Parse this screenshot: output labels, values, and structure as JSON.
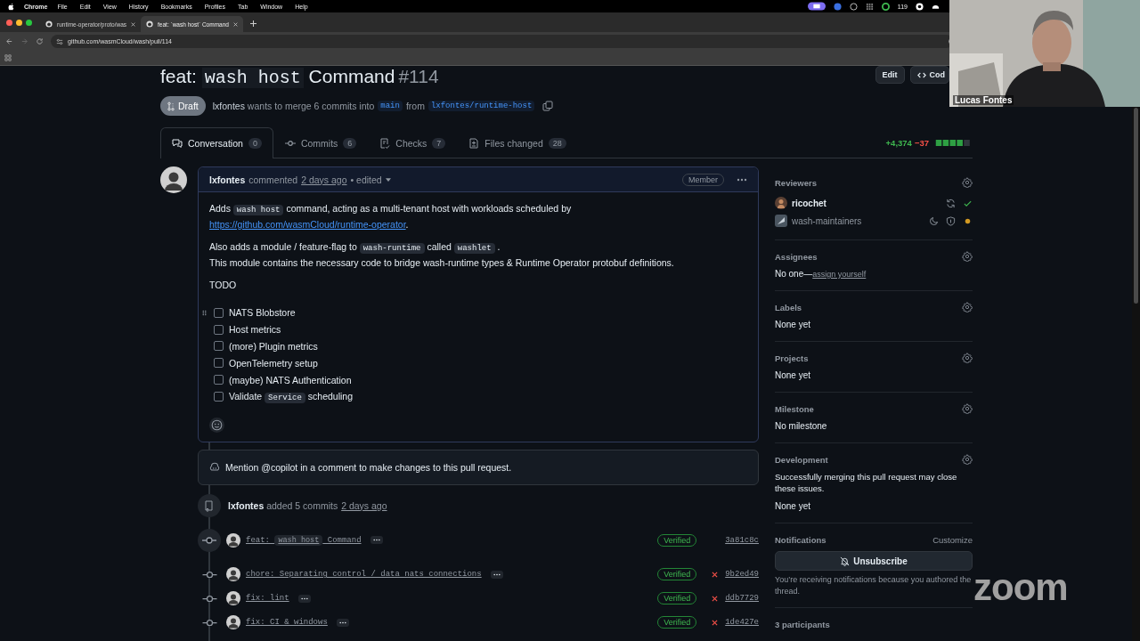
{
  "menubar": {
    "app": "Chrome",
    "items": [
      "File",
      "Edit",
      "View",
      "History",
      "Bookmarks",
      "Profiles",
      "Tab",
      "Window",
      "Help"
    ],
    "status_text": "119"
  },
  "browser_tabs": [
    {
      "title": "runtime-operator/proto/was",
      "selected": false
    },
    {
      "title": "feat: `wash host` Command",
      "selected": true
    }
  ],
  "address_bar": {
    "url": "github.com/wasmCloud/wash/pull/114"
  },
  "pr": {
    "title": [
      {
        "kind": "text",
        "text": "feat: "
      },
      {
        "kind": "code",
        "text": "wash host"
      },
      {
        "kind": "text",
        "text": " Command"
      }
    ],
    "number": "#114",
    "actions": [
      "Edit",
      "Cod"
    ],
    "state": "Draft",
    "author": "lxfontes",
    "merge_text": "wants to merge 6 commits into",
    "base": "main",
    "from_text": "from",
    "head": "lxfontes/runtime-host"
  },
  "tabs": [
    {
      "label": "Conversation",
      "count": "0",
      "selected": true
    },
    {
      "label": "Commits",
      "count": "6",
      "selected": false
    },
    {
      "label": "Checks",
      "count": "7",
      "selected": false
    },
    {
      "label": "Files changed",
      "count": "28",
      "selected": false
    }
  ],
  "diffstat": {
    "added": "+4,374",
    "removed": "−37"
  },
  "comment": {
    "author": "lxfontes",
    "action": "commented",
    "time": "2 days ago",
    "edited": "• edited",
    "badge": "Member",
    "paragraphs": [
      [
        [
          {
            "kind": "text",
            "text": "Adds "
          },
          {
            "kind": "code",
            "text": "wash host"
          },
          {
            "kind": "text",
            "text": " command, acting as a multi-tenant host with workloads scheduled by"
          }
        ],
        [
          {
            "kind": "link",
            "text": "https://github.com/wasmCloud/runtime-operator"
          },
          {
            "kind": "text",
            "text": "."
          }
        ]
      ],
      [
        [
          {
            "kind": "text",
            "text": "Also adds a module / feature-flag to "
          },
          {
            "kind": "code",
            "text": "wash-runtime"
          },
          {
            "kind": "text",
            "text": " called "
          },
          {
            "kind": "code",
            "text": "washlet"
          },
          {
            "kind": "text",
            "text": " ."
          }
        ],
        [
          {
            "kind": "text",
            "text": "This module contains the necessary code to bridge wash-runtime types & Runtime Operator protobuf definitions."
          }
        ]
      ],
      [
        [
          {
            "kind": "text",
            "text": "TODO"
          }
        ]
      ]
    ],
    "tasks": [
      {
        "checked": false,
        "text": [
          {
            "kind": "text",
            "text": "NATS Blobstore"
          }
        ]
      },
      {
        "checked": false,
        "text": [
          {
            "kind": "text",
            "text": "Host metrics"
          }
        ]
      },
      {
        "checked": false,
        "text": [
          {
            "kind": "text",
            "text": "(more) Plugin metrics"
          }
        ]
      },
      {
        "checked": false,
        "text": [
          {
            "kind": "text",
            "text": "OpenTelemetry setup"
          }
        ]
      },
      {
        "checked": false,
        "text": [
          {
            "kind": "text",
            "text": "(maybe) NATS Authentication"
          }
        ]
      },
      {
        "checked": false,
        "text": [
          {
            "kind": "text",
            "text": "Validate "
          },
          {
            "kind": "code",
            "text": "Service"
          },
          {
            "kind": "text",
            "text": " scheduling"
          }
        ]
      }
    ]
  },
  "copilot_notice": "Mention @copilot in a comment to make changes to this pull request.",
  "event": {
    "author": "lxfontes",
    "action": "added 5 commits",
    "time": "2 days ago"
  },
  "commits": [
    {
      "message": [
        {
          "kind": "text",
          "text": "feat: "
        },
        {
          "kind": "code",
          "text": "wash host"
        },
        {
          "kind": "text",
          "text": " Command"
        }
      ],
      "badge": "Verified",
      "failed": false,
      "sha": "3a81c8c"
    },
    {
      "message": [
        {
          "kind": "text",
          "text": "chore: Separating control / data nats connections"
        }
      ],
      "badge": "Verified",
      "failed": true,
      "sha": "9b2ed49"
    },
    {
      "message": [
        {
          "kind": "text",
          "text": "fix: lint"
        }
      ],
      "badge": "Verified",
      "failed": true,
      "sha": "ddb7729"
    },
    {
      "message": [
        {
          "kind": "text",
          "text": "fix: CI & windows"
        }
      ],
      "badge": "Verified",
      "failed": true,
      "sha": "1de427e"
    }
  ],
  "sidebar": [
    {
      "kind": "reviewers",
      "title": "Reviewers",
      "reviewers": [
        {
          "kind": "user",
          "name": "ricochet"
        },
        {
          "kind": "team",
          "name": "wash-maintainers"
        }
      ]
    },
    {
      "kind": "assignees",
      "title": "Assignees",
      "text": "No one—",
      "link": "assign yourself"
    },
    {
      "kind": "plain",
      "title": "Labels",
      "text": "None yet"
    },
    {
      "kind": "plain",
      "title": "Projects",
      "text": "None yet"
    },
    {
      "kind": "plain",
      "title": "Milestone",
      "text": "No milestone"
    },
    {
      "kind": "development",
      "title": "Development",
      "note": "Successfully merging this pull request may close these issues.",
      "text": "None yet"
    },
    {
      "kind": "notifications",
      "title": "Notifications",
      "action": "Customize",
      "button": "Unsubscribe",
      "note": "You’re receiving notifications because you authored the thread."
    },
    {
      "kind": "participants",
      "title": "3 participants"
    }
  ],
  "video": {
    "name": "Lucas Fontes",
    "logo": "zoom"
  }
}
